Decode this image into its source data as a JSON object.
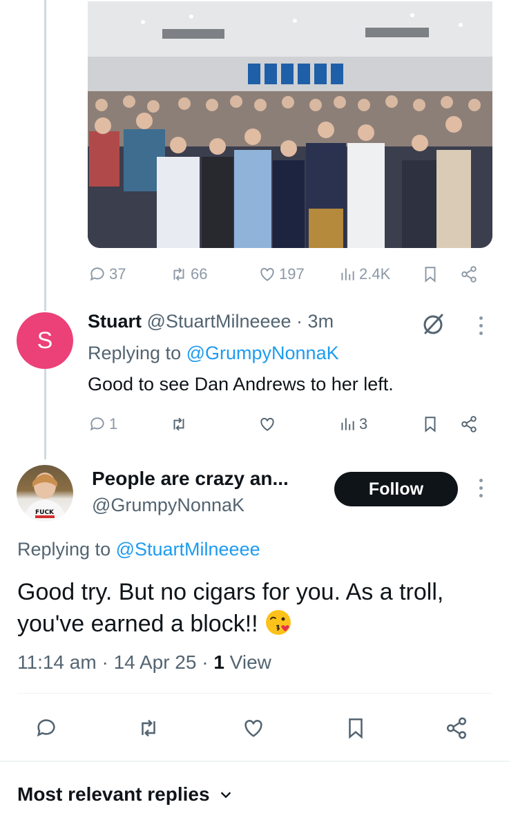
{
  "tweet_photo": {
    "alt": "Group photo of supporters at an event"
  },
  "photo_stats": {
    "replies": "37",
    "reposts": "66",
    "likes": "197",
    "views": "2.4K"
  },
  "stuart_reply": {
    "avatar_letter": "S",
    "name": "Stuart",
    "handle": "@StuartMilneeee",
    "separator": " · ",
    "time": "3m",
    "replying_prefix": "Replying to ",
    "replying_to": "@GrumpyNonnaK",
    "text": "Good to see Dan Andrews to her left.",
    "stats": {
      "replies": "1",
      "reposts": "",
      "likes": "",
      "views": "3"
    }
  },
  "main_tweet": {
    "name": "People are crazy an...",
    "handle": "@GrumpyNonnaK",
    "follow_label": "Follow",
    "replying_prefix": "Replying to ",
    "replying_to": "@StuartMilneeee",
    "text": "Good try. But no cigars for you. As a troll, you've earned a block!! ",
    "time": "11:14 am",
    "date": "14 Apr 25",
    "sep": " · ",
    "views_count": "1",
    "views_label": " View",
    "avatar_shirt_text": "FUCK"
  },
  "replies_sort": {
    "label": "Most relevant replies"
  },
  "colors": {
    "accent": "#1d9bf0",
    "avatar_pink": "#ec4079",
    "muted": "#536471",
    "follow_bg": "#0f1419"
  }
}
